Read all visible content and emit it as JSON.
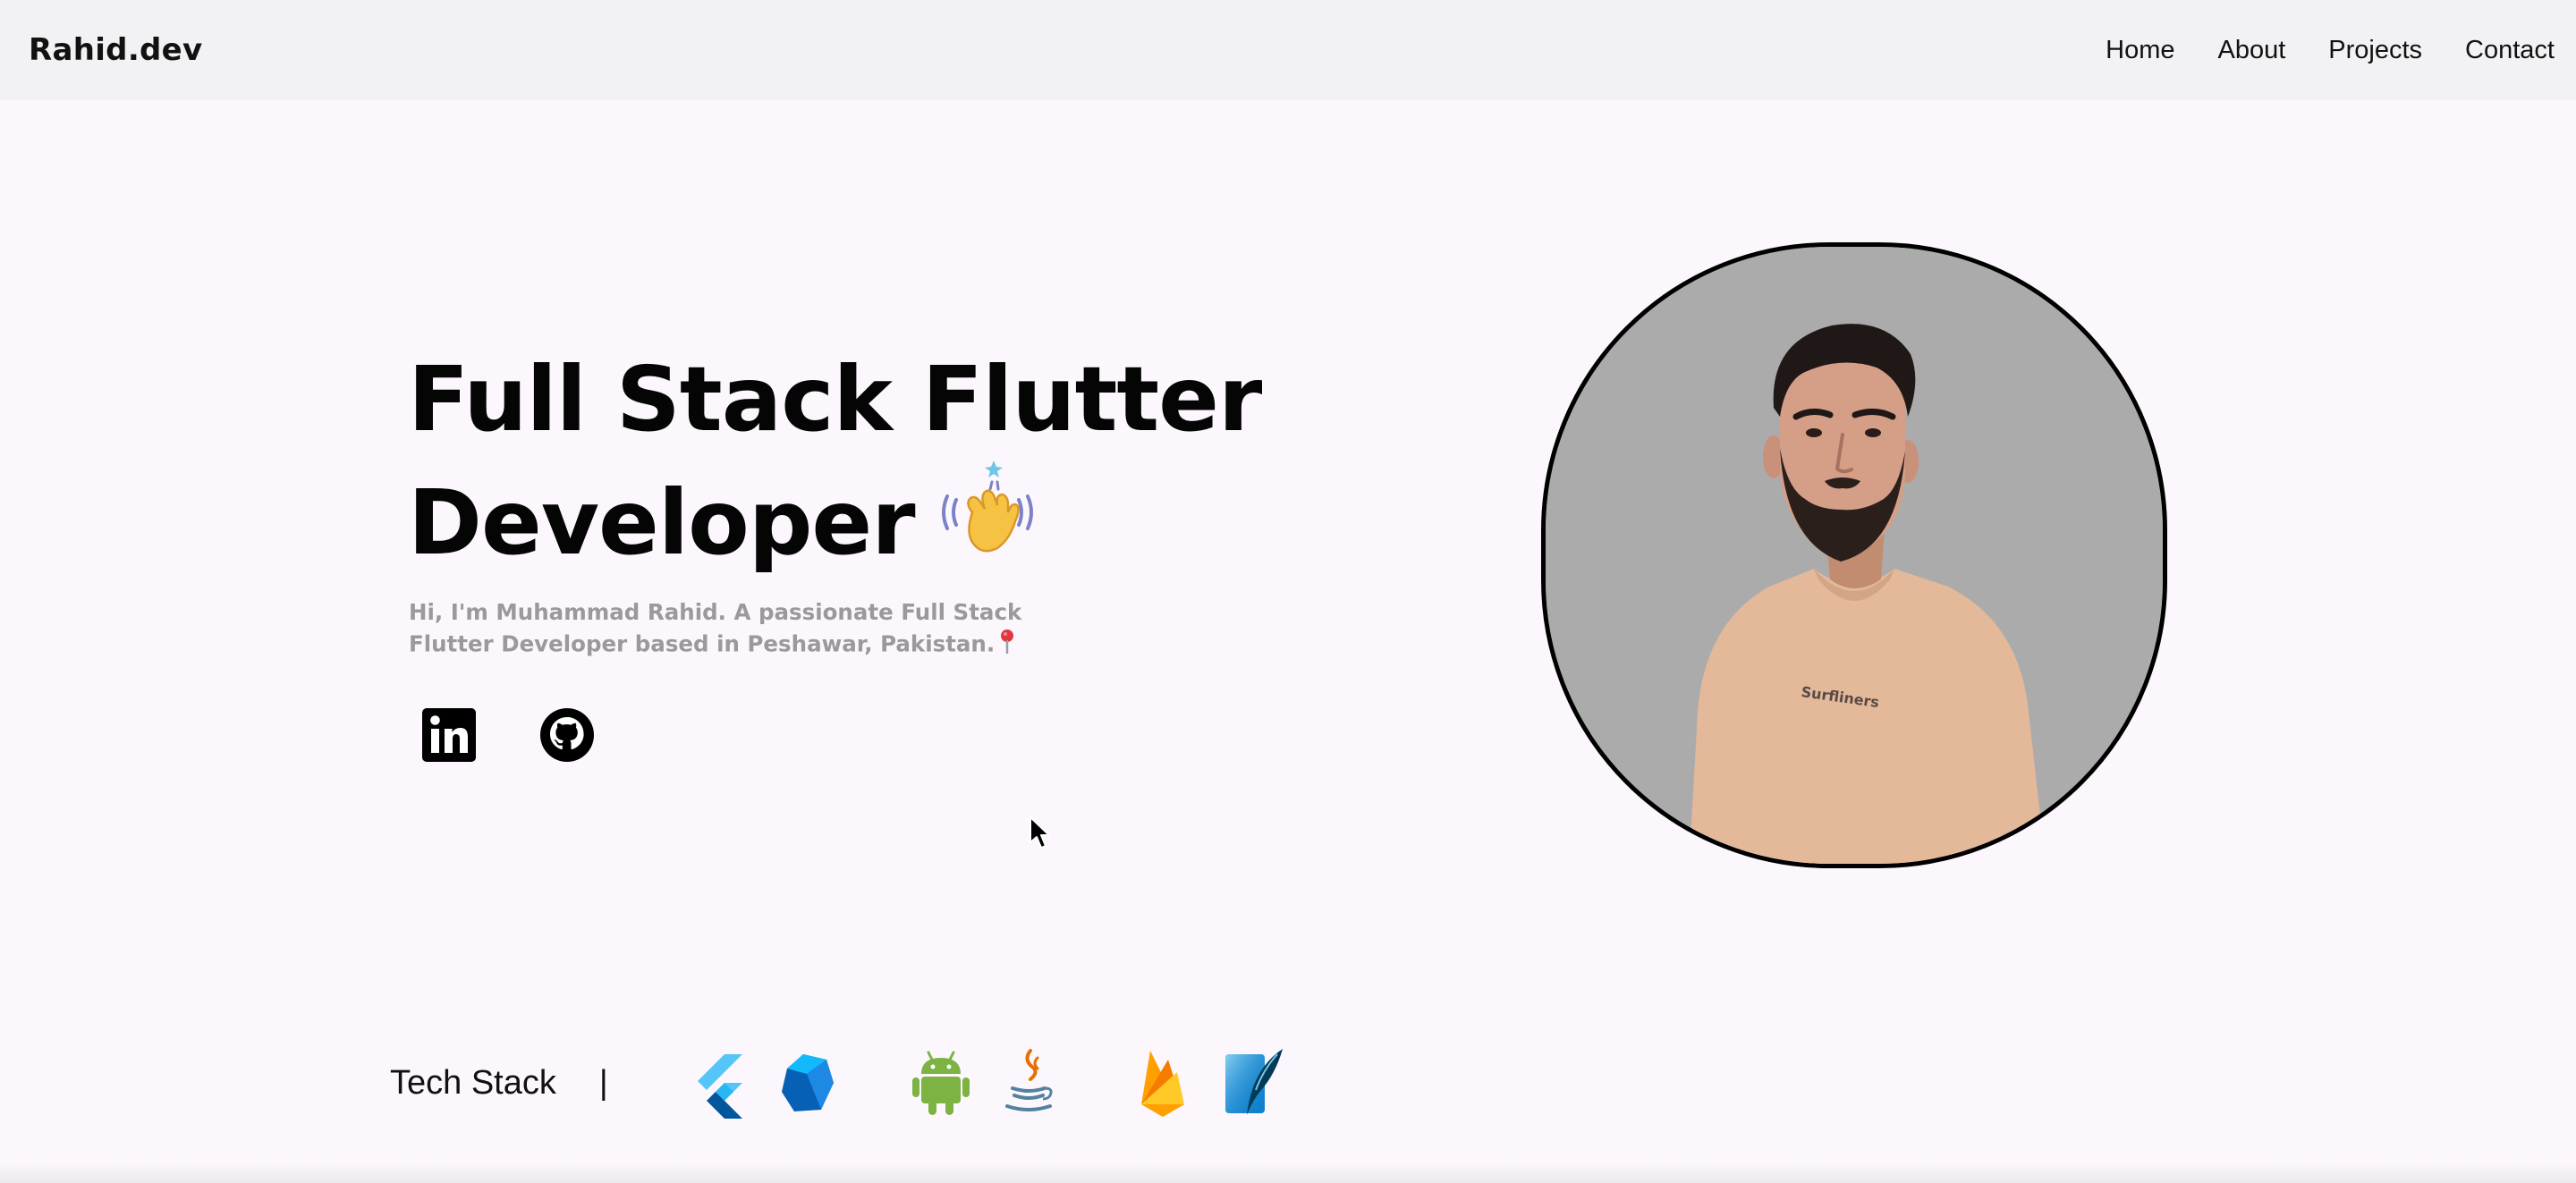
{
  "nav": {
    "brand": "Rahid.dev",
    "links": [
      "Home",
      "About",
      "Projects",
      "Contact"
    ]
  },
  "hero": {
    "title_line1": "Full Stack Flutter",
    "title_line2": "Developer",
    "wave_icon": "waving-hand-emoji",
    "description": "Hi, I'm Muhammad Rahid. A passionate Full Stack Flutter Developer based in Peshawar, Pakistan.",
    "pin_icon": "round-pushpin-emoji"
  },
  "socials": [
    {
      "name": "LinkedIn",
      "icon": "linkedin-icon"
    },
    {
      "name": "GitHub",
      "icon": "github-icon"
    }
  ],
  "avatar": {
    "icon": "profile-photo",
    "background": "#ababab"
  },
  "tech_stack": {
    "label": "Tech Stack",
    "separator": "|",
    "icons": [
      "flutter-icon",
      "dart-icon",
      "android-icon",
      "java-icon",
      "firebase-icon",
      "sqlite-icon"
    ]
  },
  "colors": {
    "page_bg": "#fcf7fd",
    "navbar_bg": "#f2f2f4",
    "text": "#050505",
    "muted": "#9a9a9a"
  }
}
